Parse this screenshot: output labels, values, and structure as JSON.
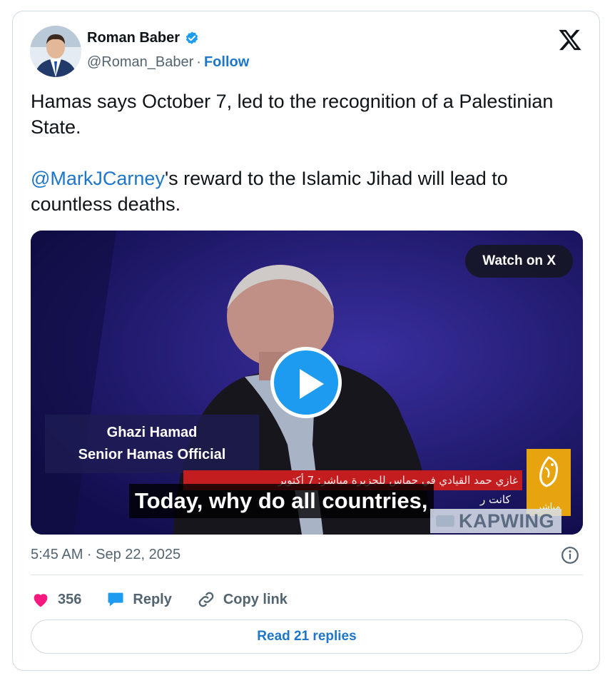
{
  "author": {
    "name": "Roman Baber",
    "handle": "@Roman_Baber",
    "separator": "·",
    "follow_label": "Follow",
    "verified": true
  },
  "tweet": {
    "line1": "Hamas says October 7, led to the recognition of a Palestinian State.",
    "mention": "@MarkJCarney",
    "line2_rest": "'s reward to the Islamic Jihad will lead to countless deaths."
  },
  "media": {
    "watch_label": "Watch on X",
    "lower_third_name": "Ghazi Hamad",
    "lower_third_title": "Senior Hamas Official",
    "arabic_ticker": "غازي حمد القيادي في حماس للجزيرة مباشر: 7 أكتوبر",
    "arabic_ticker2": "كانت ر",
    "arabic_channel": "مباشر",
    "caption": "Today, why do all countries,",
    "watermark": "KAPWING"
  },
  "meta": {
    "timestamp": "5:45 AM · Sep 22, 2025"
  },
  "actions": {
    "likes": "356",
    "reply_label": "Reply",
    "copy_label": "Copy link"
  },
  "footer": {
    "read_replies": "Read 21 replies"
  },
  "colors": {
    "link": "#1d76c9",
    "like": "#f91880",
    "reply_bubble": "#1d9bf0",
    "play": "#1d9bf0"
  }
}
